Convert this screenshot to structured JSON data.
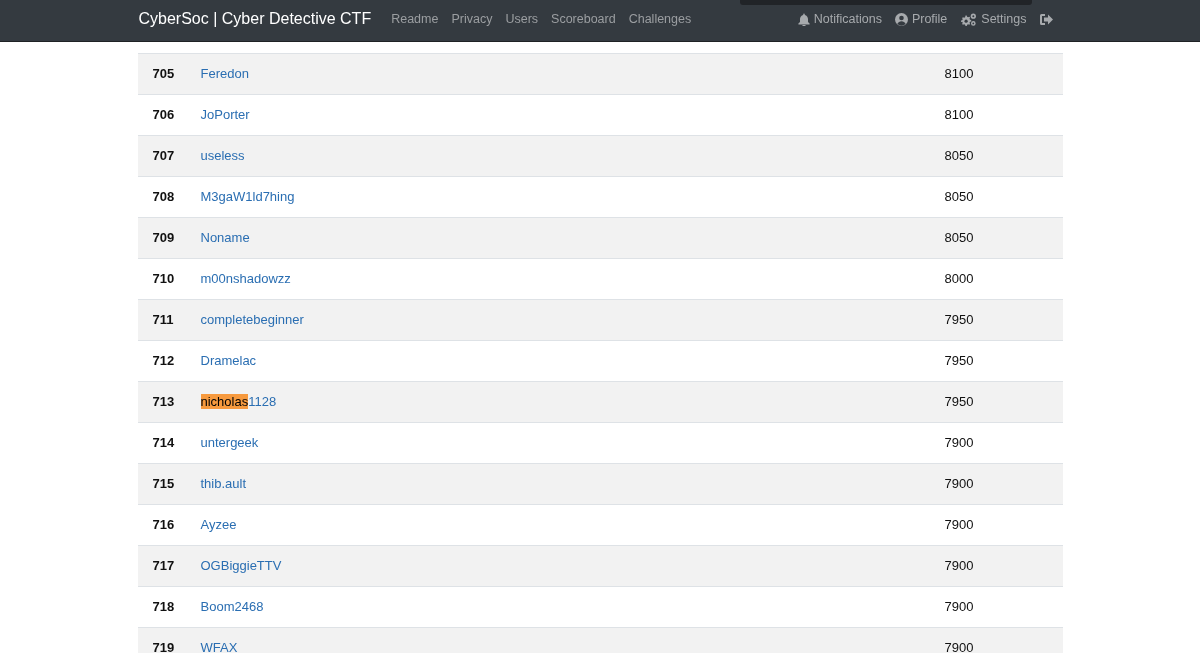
{
  "navbar": {
    "brand": "CyberSoc | Cyber Detective CTF",
    "links": [
      {
        "label": "Readme"
      },
      {
        "label": "Privacy"
      },
      {
        "label": "Users"
      },
      {
        "label": "Scoreboard"
      },
      {
        "label": "Challenges"
      }
    ],
    "user_menu": [
      {
        "kind": "notifications",
        "label": "Notifications"
      },
      {
        "kind": "profile",
        "label": "Profile"
      },
      {
        "kind": "settings",
        "label": "Settings"
      },
      {
        "kind": "logout"
      }
    ]
  },
  "scoreboard": {
    "rows": [
      {
        "rank": "705",
        "name": [
          {
            "text": "Feredon",
            "highlighted": false
          }
        ],
        "score": "8100"
      },
      {
        "rank": "706",
        "name": [
          {
            "text": "JoPorter",
            "highlighted": false
          }
        ],
        "score": "8100"
      },
      {
        "rank": "707",
        "name": [
          {
            "text": "useless",
            "highlighted": false
          }
        ],
        "score": "8050"
      },
      {
        "rank": "708",
        "name": [
          {
            "text": "M3gaW1ld7hing",
            "highlighted": false
          }
        ],
        "score": "8050"
      },
      {
        "rank": "709",
        "name": [
          {
            "text": "Noname",
            "highlighted": false
          }
        ],
        "score": "8050"
      },
      {
        "rank": "710",
        "name": [
          {
            "text": "m00nshadowzz",
            "highlighted": false
          }
        ],
        "score": "8000"
      },
      {
        "rank": "711",
        "name": [
          {
            "text": "completebeginner",
            "highlighted": false
          }
        ],
        "score": "7950"
      },
      {
        "rank": "712",
        "name": [
          {
            "text": "Dramelac",
            "highlighted": false
          }
        ],
        "score": "7950"
      },
      {
        "rank": "713",
        "name": [
          {
            "text": "nicholas",
            "highlighted": true
          },
          {
            "text": "1128",
            "highlighted": false
          }
        ],
        "score": "7950"
      },
      {
        "rank": "714",
        "name": [
          {
            "text": "untergeek",
            "highlighted": false
          }
        ],
        "score": "7900"
      },
      {
        "rank": "715",
        "name": [
          {
            "text": "thib.ault",
            "highlighted": false
          }
        ],
        "score": "7900"
      },
      {
        "rank": "716",
        "name": [
          {
            "text": "Ayzee",
            "highlighted": false
          }
        ],
        "score": "7900"
      },
      {
        "rank": "717",
        "name": [
          {
            "text": "OGBiggieTTV",
            "highlighted": false
          }
        ],
        "score": "7900"
      },
      {
        "rank": "718",
        "name": [
          {
            "text": "Boom2468",
            "highlighted": false
          }
        ],
        "score": "7900"
      },
      {
        "rank": "719",
        "name": [
          {
            "text": "WFAX",
            "highlighted": false
          }
        ],
        "score": "7900"
      }
    ]
  }
}
